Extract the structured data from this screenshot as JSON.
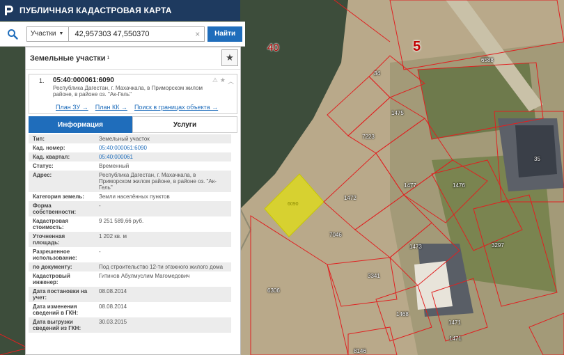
{
  "header": {
    "title": "ПУБЛИЧНАЯ КАДАСТРОВАЯ КАРТА"
  },
  "search": {
    "type_label": "Участки",
    "query": "42,957303 47,550370",
    "clear_glyph": "×",
    "button_label": "Найти"
  },
  "panel": {
    "title": "Земельные участки",
    "count": "1",
    "item": {
      "index": "1.",
      "cadastral_number": "05:40:000061:6090",
      "address": "Республика Дагестан, г. Махачкала, в Приморском жилом районе, в районе оз. \"Ак-Гель\"",
      "links": [
        "План ЗУ →",
        "План КК →",
        "Поиск в границах объекта →"
      ]
    },
    "tabs": [
      "Информация",
      "Услуги"
    ],
    "rows": [
      {
        "key": "Тип:",
        "value": "Земельный участок"
      },
      {
        "key": "Кад. номер:",
        "value": "05:40:000061:6090"
      },
      {
        "key": "Кад. квартал:",
        "value": "05:40:000061"
      },
      {
        "key": "Статус:",
        "value": "Временный"
      },
      {
        "key": "Адрес:",
        "value": "Республика Дагестан, г. Махачкала, в Приморском жилом районе, в районе оз. \"Ак-Гель\""
      },
      {
        "key": "Категория земель:",
        "value": "Земли населённых пунктов"
      },
      {
        "key": "Форма собственности:",
        "value": "-"
      },
      {
        "key": "Кадастровая стоимость:",
        "value": "9 251 589,66 руб."
      },
      {
        "key": "Уточненная площадь:",
        "value": "1 202 кв. м"
      },
      {
        "key": "Разрешенное использование:",
        "value": "-"
      },
      {
        "key": "по документу:",
        "value": "Под строительство 12-ти этажного жилого дома"
      },
      {
        "key": "Кадастровый инженер:",
        "value": "Гитинов Абулмуслим Магомедович"
      },
      {
        "key": "Дата постановки на учет:",
        "value": "08.08.2014"
      },
      {
        "key": "Дата изменения сведений в ГКН:",
        "value": "08.08.2014"
      },
      {
        "key": "Дата выгрузки сведений из ГКН:",
        "value": "30.03.2015"
      }
    ]
  },
  "map": {
    "labels": {
      "district_40": "40",
      "quarter_5": "5",
      "p34": "34",
      "p1475": "1475",
      "p7223": "7223",
      "p6588": "6588",
      "p6090": "6090",
      "p1472": "1472",
      "p1477": "1477",
      "p1476": "1476",
      "p35": "35",
      "p7046": "7046",
      "p1473": "1473",
      "p3297": "3297",
      "p3341": "3341",
      "p6306": "6306",
      "p1468": "1468",
      "p1471a": "1471",
      "p1471b": "1471",
      "p8146": "8146"
    }
  },
  "colors": {
    "header_bg": "#1e3a5f",
    "accent": "#1f6dbb",
    "parcel_outline": "#e02020",
    "selected_fill": "#e6e600"
  }
}
